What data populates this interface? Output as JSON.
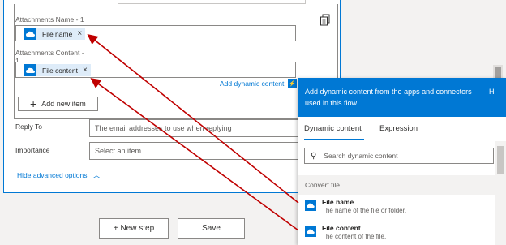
{
  "attachments": {
    "name_label": "Attachments Name - 1",
    "name_token": "File name",
    "content_label_line1": "Attachments Content -",
    "content_label_line2": "1",
    "content_token": "File content",
    "token_remove_glyph": "×",
    "add_dynamic_link": "Add dynamic content",
    "add_item_label": "Add new item",
    "add_item_icon": "plus-icon",
    "copy_icon": "copy-icon"
  },
  "fields": {
    "reply_to_label": "Reply To",
    "reply_to_placeholder": "The email addresses to use when replying",
    "importance_label": "Importance",
    "importance_placeholder": "Select an item"
  },
  "hide_advanced": "Hide advanced options",
  "buttons": {
    "new_step": "+ New step",
    "save": "Save"
  },
  "dynamic_panel": {
    "header_line1": "Add dynamic content from the apps and connectors",
    "header_line2": "used in this flow.",
    "header_trailing": "H",
    "tabs": [
      "Dynamic content",
      "Expression"
    ],
    "search_placeholder": "Search dynamic content",
    "section_title": "Convert file",
    "items": [
      {
        "title": "File name",
        "desc": "The name of the file or folder."
      },
      {
        "title": "File content",
        "desc": "The content of the file."
      }
    ]
  },
  "colors": {
    "accent": "#0078d4",
    "token_bg": "#deecf9",
    "arrow": "#c00000"
  }
}
